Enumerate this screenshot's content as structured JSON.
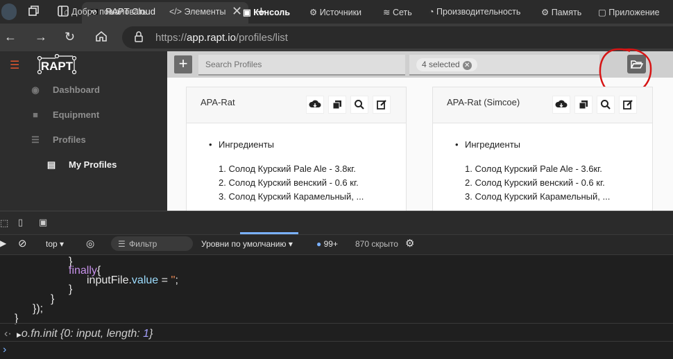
{
  "browser": {
    "tab_title": "RAPT Cloud",
    "url_scheme": "https://",
    "url_host": "app.rapt.io",
    "url_path": "/profiles/list"
  },
  "sidebar": {
    "logo": "RAPT",
    "items": [
      {
        "label": "Dashboard",
        "icon": "dashboard-icon"
      },
      {
        "label": "Equipment",
        "icon": "toolbox-icon"
      },
      {
        "label": "Profiles",
        "icon": "list-icon"
      },
      {
        "label": "My Profiles",
        "icon": "clipboard-icon"
      }
    ]
  },
  "toolbar": {
    "search_placeholder": "Search Profiles",
    "selected_chip": "4 selected"
  },
  "cards": [
    {
      "title": "APA-Rat",
      "bullet": "Ингредиенты",
      "items": [
        "1. Солод Курский Pale Ale - 3.8кг.",
        "2. Солод Курский венский - 0.6 кг.",
        "3. Солод Курский Карамельный, ..."
      ]
    },
    {
      "title": "APA-Rat (Simcoe)",
      "bullet": "Ингредиенты",
      "items": [
        "1. Солод Курский Pale Ale - 3.6кг.",
        "2. Солод Курский венский - 0.6 кг.",
        "3. Солод Курский Карамельный, ..."
      ]
    }
  ],
  "devtools": {
    "tabs": [
      "Добро пожаловать",
      "Элементы",
      "Консоль",
      "Источники",
      "Сеть",
      "Производительность",
      "Память",
      "Приложение"
    ],
    "context": "top",
    "filter_placeholder": "Фильтр",
    "levels": "Уровни по умолчанию",
    "issues": "99+",
    "hidden": "870 скрыто"
  },
  "console": {
    "l1": "}",
    "l2_kw": "finally",
    "l2_rest": "{",
    "l3_obj": "inputFile.",
    "l3_prop": "value",
    "l3_eq": " = ",
    "l3_str": "''",
    "l3_end": ";",
    "l4": "}",
    "l5": "}",
    "l6": "});",
    "l7": "}",
    "result_prefix": "o.fn.init {0: ",
    "result_input": "input",
    "result_mid": ", length: ",
    "result_len": "1",
    "result_end": "}"
  }
}
